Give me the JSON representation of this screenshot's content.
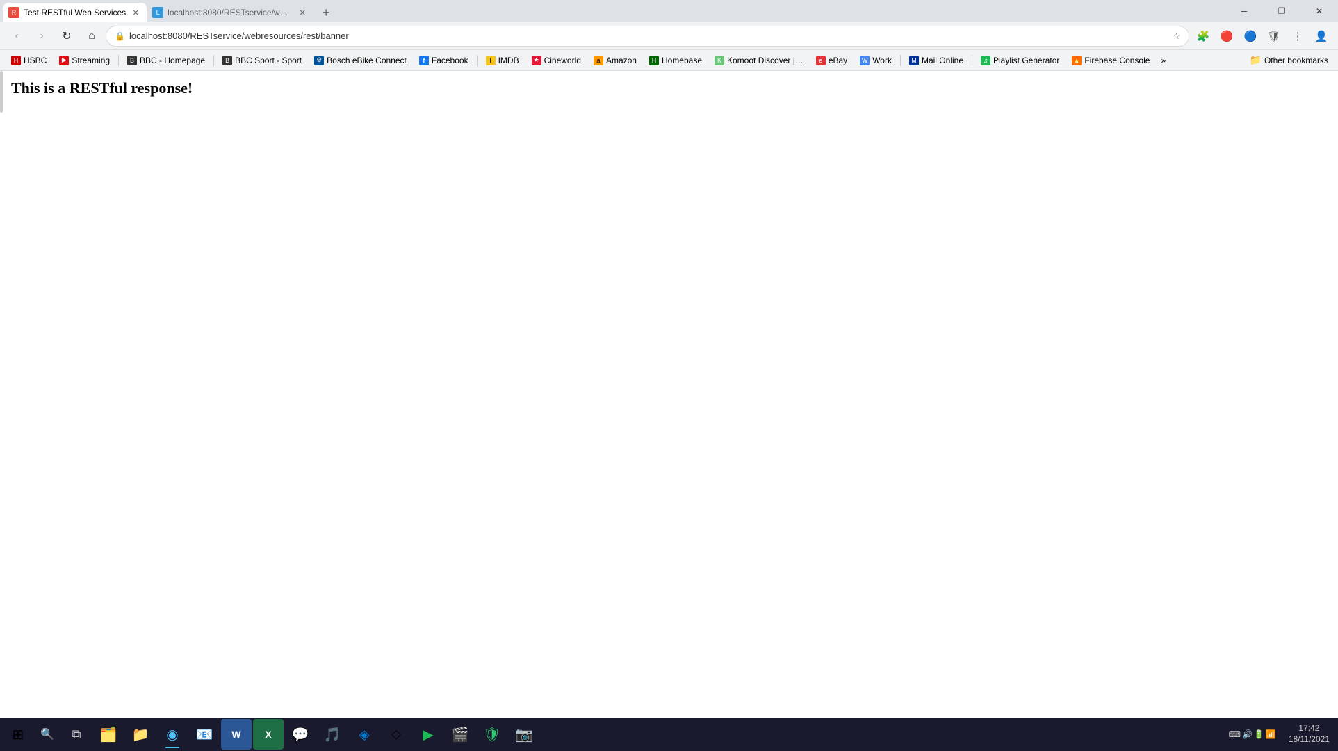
{
  "window": {
    "title": "Test RESTful Web Services"
  },
  "tabs": [
    {
      "id": "tab1",
      "title": "Test RESTful Web Services",
      "url": "localhost:8080/RESTservice/webresources/rest/banner",
      "active": true,
      "favicon_color": "#e74c3c",
      "favicon_char": "🔴"
    },
    {
      "id": "tab2",
      "title": "localhost:8080/RESTservice/web…",
      "url": "localhost:8080/RESTservice/web…",
      "active": false,
      "favicon_color": "#3498db",
      "favicon_char": "🔵"
    }
  ],
  "nav": {
    "url": "localhost:8080/RESTservice/webresources/rest/banner",
    "back_enabled": false,
    "forward_enabled": false
  },
  "bookmarks": [
    {
      "id": "bm-hsbc",
      "label": "HSBC",
      "favicon_char": "🏦",
      "favicon_bg": "#cc0000"
    },
    {
      "id": "bm-streaming",
      "label": "Streaming",
      "favicon_char": "▶",
      "favicon_bg": "#e50914",
      "show_dots": true
    },
    {
      "id": "bm-bbc-homepage",
      "label": "BBC - Homepage",
      "favicon_char": "B",
      "favicon_bg": "#333"
    },
    {
      "id": "bm-bbc-sport",
      "label": "BBC Sport - Sport",
      "favicon_char": "B",
      "favicon_bg": "#333",
      "show_dots": true
    },
    {
      "id": "bm-bosch",
      "label": "Bosch eBike Connect",
      "favicon_char": "⚙",
      "favicon_bg": "#00529b"
    },
    {
      "id": "bm-facebook",
      "label": "Facebook",
      "favicon_char": "f",
      "favicon_bg": "#1877f2"
    },
    {
      "id": "bm-imdb",
      "label": "IMDB",
      "favicon_char": "I",
      "favicon_bg": "#f5c518",
      "show_dots": true
    },
    {
      "id": "bm-cineworld",
      "label": "Cineworld",
      "favicon_char": "★",
      "favicon_bg": "#e31837"
    },
    {
      "id": "bm-amazon",
      "label": "Amazon",
      "favicon_char": "a",
      "favicon_bg": "#ff9900"
    },
    {
      "id": "bm-homebase",
      "label": "Homebase",
      "favicon_char": "H",
      "favicon_bg": "#006400"
    },
    {
      "id": "bm-komoot",
      "label": "Komoot Discover |…",
      "favicon_char": "K",
      "favicon_bg": "#6bc37a"
    },
    {
      "id": "bm-ebay",
      "label": "eBay",
      "favicon_char": "e",
      "favicon_bg": "#e53238"
    },
    {
      "id": "bm-work",
      "label": "Work",
      "favicon_char": "W",
      "favicon_bg": "#4285f4"
    },
    {
      "id": "bm-mailonline",
      "label": "Mail Online",
      "favicon_char": "M",
      "favicon_bg": "#003399",
      "show_dots": true
    },
    {
      "id": "bm-playlist",
      "label": "Playlist Generator",
      "favicon_char": "♫",
      "favicon_bg": "#1db954",
      "show_dots": true
    },
    {
      "id": "bm-firebase",
      "label": "Firebase Console",
      "favicon_char": "🔥",
      "favicon_bg": "#ff6d00"
    }
  ],
  "bookmarks_more_label": "»",
  "other_bookmarks_label": "Other bookmarks",
  "page": {
    "heading": "This is a RESTful response!"
  },
  "taskbar": {
    "apps": [
      {
        "id": "tb-start",
        "icon": "⊞",
        "type": "start"
      },
      {
        "id": "tb-search",
        "icon": "🔍",
        "type": "search"
      },
      {
        "id": "tb-taskview",
        "icon": "⧉",
        "type": "button"
      },
      {
        "id": "tb-explorer",
        "icon": "🗂️",
        "type": "app"
      },
      {
        "id": "tb-chrome",
        "icon": "◉",
        "type": "app",
        "active": true
      },
      {
        "id": "tb-outlook",
        "icon": "📧",
        "type": "app"
      },
      {
        "id": "tb-word",
        "icon": "W",
        "type": "app",
        "color": "#2b5797"
      },
      {
        "id": "tb-excel",
        "icon": "X",
        "type": "app",
        "color": "#1e6f45"
      },
      {
        "id": "tb-whatsapp",
        "icon": "💬",
        "type": "app"
      },
      {
        "id": "tb-spotify",
        "icon": "🎵",
        "type": "app"
      },
      {
        "id": "tb-vscode",
        "icon": "⌨",
        "type": "app"
      },
      {
        "id": "tb-git",
        "icon": "⬦",
        "type": "app"
      },
      {
        "id": "tb-terminal",
        "icon": "▶",
        "type": "app"
      },
      {
        "id": "tb-media",
        "icon": "🎬",
        "type": "app"
      },
      {
        "id": "tb-shield",
        "icon": "🛡",
        "type": "app"
      },
      {
        "id": "tb-cam",
        "icon": "📷",
        "type": "app"
      }
    ],
    "systray": {
      "icons": [
        "⌨",
        "🔊",
        "🔋",
        "📶"
      ],
      "time": "17:42",
      "date": "18/11/2021"
    }
  }
}
